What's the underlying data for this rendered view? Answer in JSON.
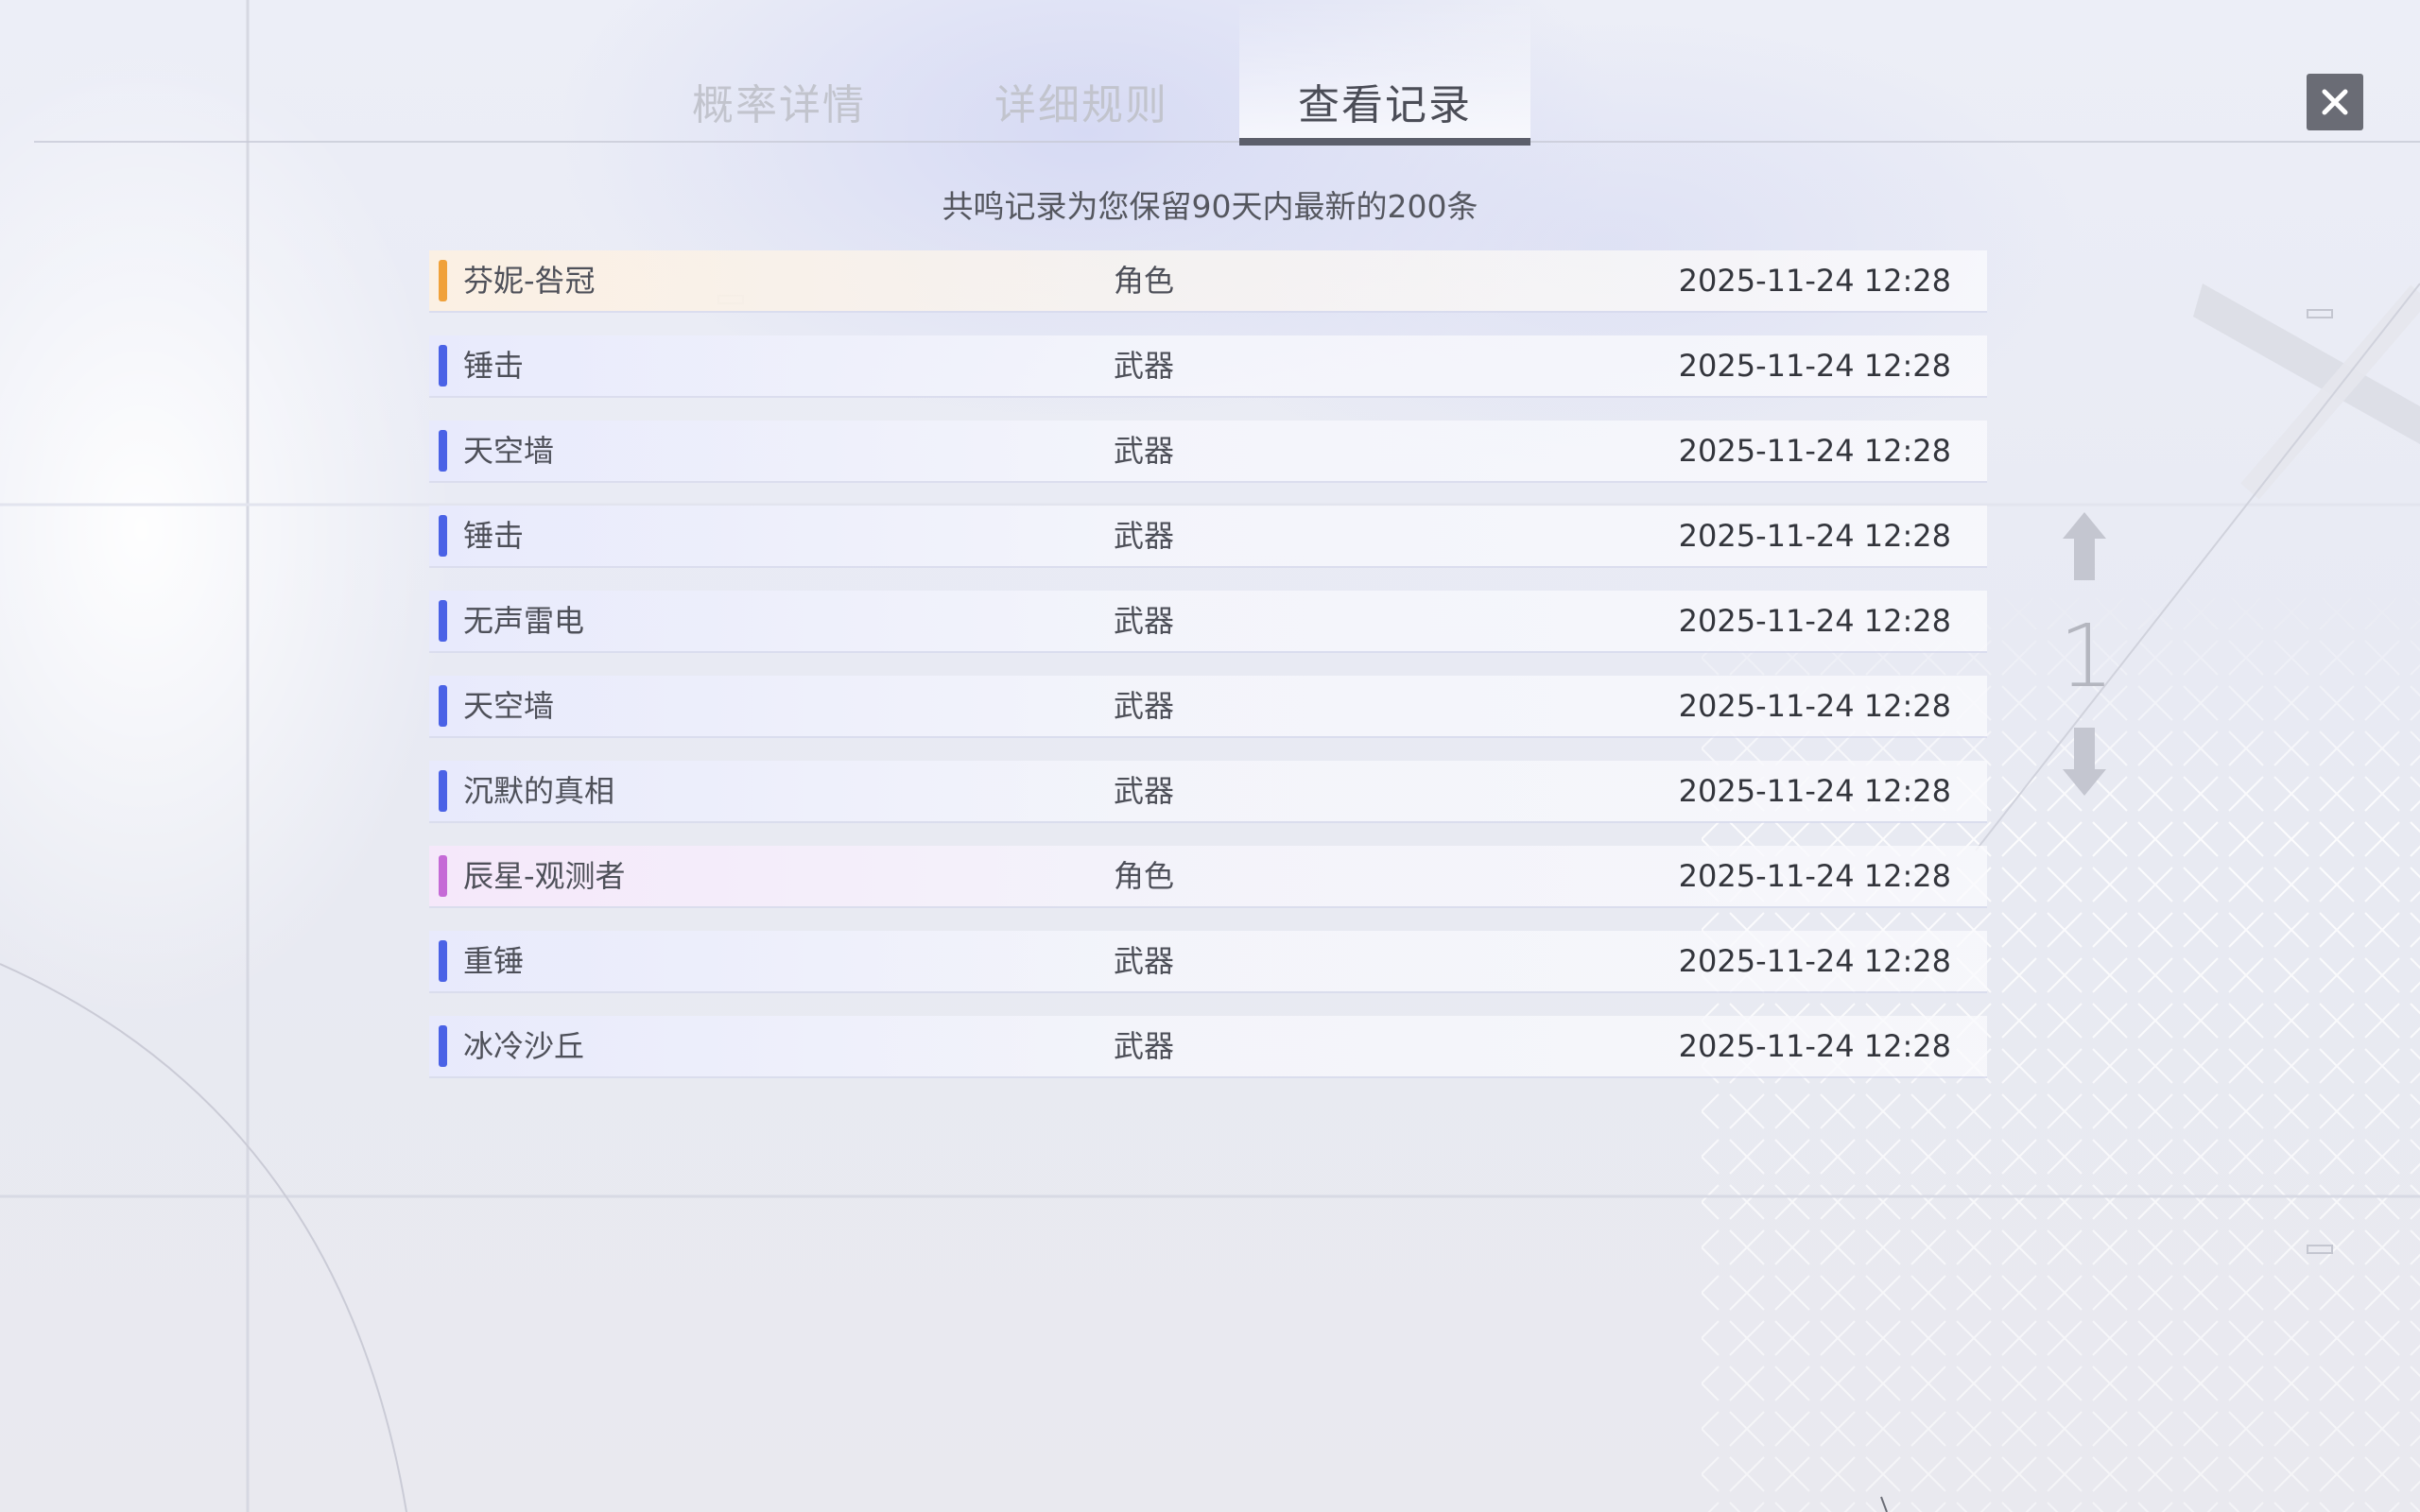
{
  "tabs": [
    {
      "label": "概率详情",
      "active": false
    },
    {
      "label": "详细规则",
      "active": false
    },
    {
      "label": "查看记录",
      "active": true
    }
  ],
  "close_icon": "close-icon",
  "subtitle": "共鸣记录为您保留90天内最新的200条",
  "records": [
    {
      "name": "芬妮-咎冠",
      "type": "角色",
      "time": "2025-11-24 12:28",
      "rarity": "gold"
    },
    {
      "name": "锤击",
      "type": "武器",
      "time": "2025-11-24 12:28",
      "rarity": "blue"
    },
    {
      "name": "天空墙",
      "type": "武器",
      "time": "2025-11-24 12:28",
      "rarity": "blue"
    },
    {
      "name": "锤击",
      "type": "武器",
      "time": "2025-11-24 12:28",
      "rarity": "blue"
    },
    {
      "name": "无声雷电",
      "type": "武器",
      "time": "2025-11-24 12:28",
      "rarity": "blue"
    },
    {
      "name": "天空墙",
      "type": "武器",
      "time": "2025-11-24 12:28",
      "rarity": "blue"
    },
    {
      "name": "沉默的真相",
      "type": "武器",
      "time": "2025-11-24 12:28",
      "rarity": "blue"
    },
    {
      "name": "辰星-观测者",
      "type": "角色",
      "time": "2025-11-24 12:28",
      "rarity": "purple"
    },
    {
      "name": "重锤",
      "type": "武器",
      "time": "2025-11-24 12:28",
      "rarity": "blue"
    },
    {
      "name": "冰冷沙丘",
      "type": "武器",
      "time": "2025-11-24 12:28",
      "rarity": "blue"
    }
  ],
  "rarity_colors": {
    "gold": "#f0a13a",
    "blue": "#4a62e6",
    "purple": "#c56ad6"
  },
  "pager": {
    "page": "1",
    "prev_icon": "arrow-up-icon",
    "next_icon": "arrow-down-icon"
  }
}
